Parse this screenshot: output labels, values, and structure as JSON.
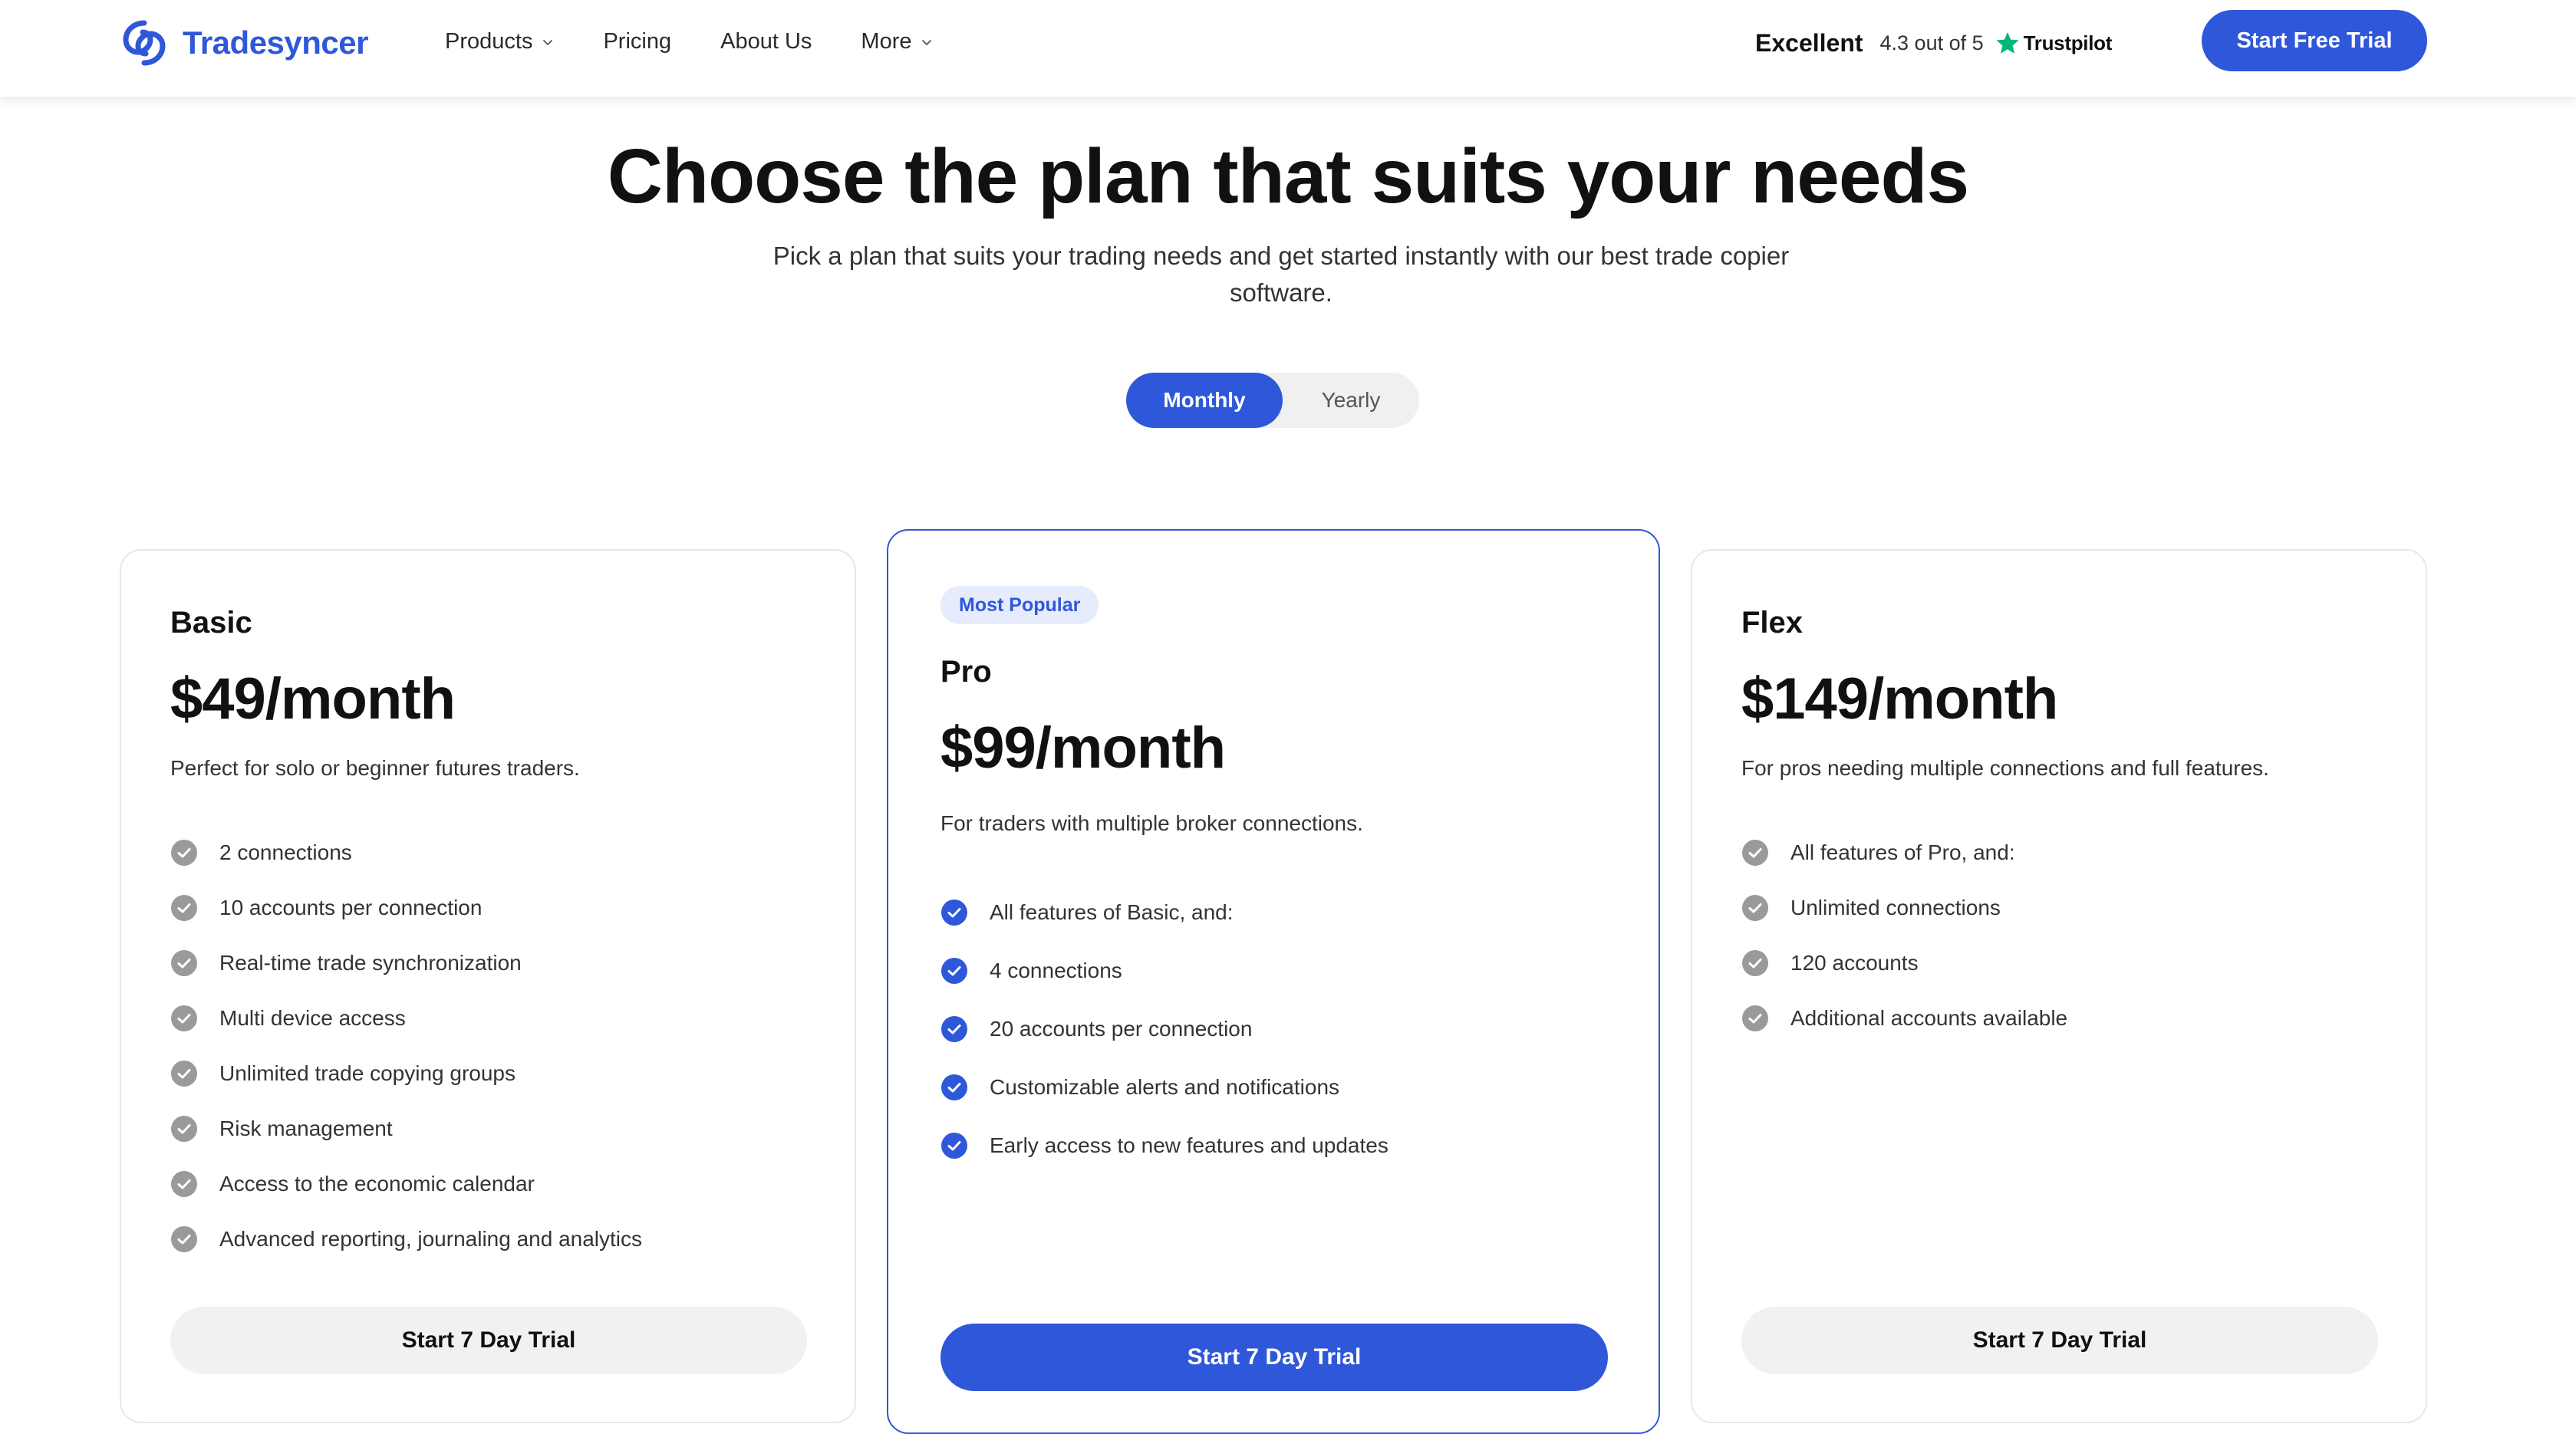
{
  "brand": {
    "name": "Tradesyncer",
    "color": "#2f57d9"
  },
  "nav": {
    "items": [
      {
        "label": "Products",
        "has_dropdown": true
      },
      {
        "label": "Pricing",
        "has_dropdown": false
      },
      {
        "label": "About Us",
        "has_dropdown": false
      },
      {
        "label": "More",
        "has_dropdown": true
      }
    ]
  },
  "rating": {
    "label": "Excellent",
    "score": "4.3 out of 5",
    "provider": "Trustpilot",
    "star_color": "#00b67a"
  },
  "header_cta": "Start Free Trial",
  "hero": {
    "title": "Choose the plan that suits your needs",
    "subtitle": "Pick a plan that suits your trading needs and get started instantly with our best trade copier software."
  },
  "billing_toggle": {
    "options": [
      "Monthly",
      "Yearly"
    ],
    "selected": "Monthly"
  },
  "plans": {
    "basic": {
      "name": "Basic",
      "price": "$49/month",
      "description": "Perfect for solo or beginner futures traders.",
      "features": [
        "2 connections",
        "10 accounts per connection",
        "Real-time trade synchronization",
        "Multi device access",
        "Unlimited trade copying groups",
        "Risk management",
        "Access to the economic calendar",
        "Advanced reporting, journaling and analytics"
      ],
      "cta": "Start 7 Day Trial"
    },
    "pro": {
      "badge": "Most Popular",
      "name": "Pro",
      "price": "$99/month",
      "description": "For traders with multiple broker connections.",
      "features": [
        "All features of Basic, and:",
        "4 connections",
        "20 accounts per connection",
        "Customizable alerts and notifications",
        "Early access to new features and updates"
      ],
      "cta": "Start 7 Day Trial"
    },
    "flex": {
      "name": "Flex",
      "price": "$149/month",
      "description": "For pros needing multiple connections and full features.",
      "features": [
        "All features of Pro, and:",
        "Unlimited connections",
        "120 accounts",
        "Additional accounts available"
      ],
      "cta": "Start 7 Day Trial"
    }
  },
  "icons": {
    "logo": "tradesyncer-logo-icon",
    "chevron": "chevron-down-icon",
    "star": "trustpilot-star-icon",
    "check_gray": "check-circle-gray-icon",
    "check_blue": "check-circle-blue-icon"
  }
}
